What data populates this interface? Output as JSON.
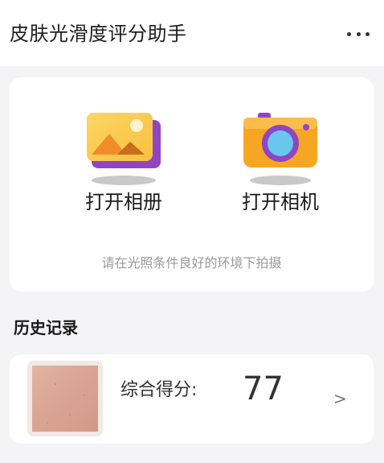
{
  "header": {
    "title": "皮肤光滑度评分助手",
    "more_icon": "more-dots-icon"
  },
  "actions": {
    "album": {
      "label": "打开相册",
      "icon": "photo-album-icon"
    },
    "camera": {
      "label": "打开相机",
      "icon": "camera-icon"
    }
  },
  "hint": "请在光照条件良好的环境下拍摄",
  "history": {
    "title": "历史记录",
    "items": [
      {
        "score_label": "综合得分:",
        "score": "77",
        "chevron": ">"
      }
    ]
  },
  "colors": {
    "background": "#f4f4f6",
    "card": "#ffffff",
    "album_yellow": "#f9c94a",
    "album_purple": "#8f45c4",
    "camera_orange": "#f6a623",
    "camera_lens": "#69c7ee"
  }
}
